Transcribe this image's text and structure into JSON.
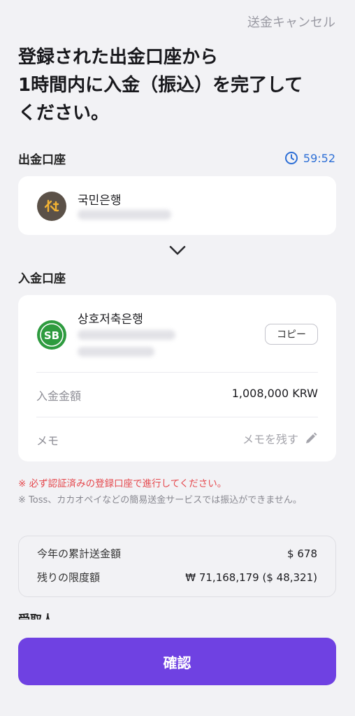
{
  "header": {
    "cancel_label": "送金キャンセル"
  },
  "headline": {
    "line1": "登録された出金口座から",
    "line2": "1時間内に入金（振込）を完了して",
    "line3": "ください。"
  },
  "source": {
    "section_label": "出金口座",
    "timer": "59:52",
    "bank_name": "국민은행"
  },
  "destination": {
    "section_label": "入金口座",
    "bank_name": "상호저축은행",
    "copy_label": "コピー",
    "amount_label": "入金金額",
    "amount_value": "1,008,000 KRW",
    "memo_label": "メモ",
    "memo_action": "メモを残す"
  },
  "notices": {
    "warning": "※ 必ず認証済みの登録口座で進行してください。",
    "note": "※ Toss、カカオペイなどの簡易送金サービスでは振込ができません。"
  },
  "limits": {
    "yearly_label": "今年の累計送金額",
    "yearly_value": "$ 678",
    "remaining_label": "残りの限度額",
    "remaining_value": "₩ 71,168,179 ($ 48,321)"
  },
  "next_section_label": "受取人",
  "confirm_label": "確認",
  "colors": {
    "accent": "#6f41e2",
    "timer": "#2d6fd6",
    "warning": "#e5484d",
    "kb_logo": "#5b5148",
    "sb_logo": "#2e9b3f"
  },
  "icons": {
    "timer": "clock-icon",
    "chevron": "chevron-down-icon",
    "memo": "pencil-icon"
  }
}
